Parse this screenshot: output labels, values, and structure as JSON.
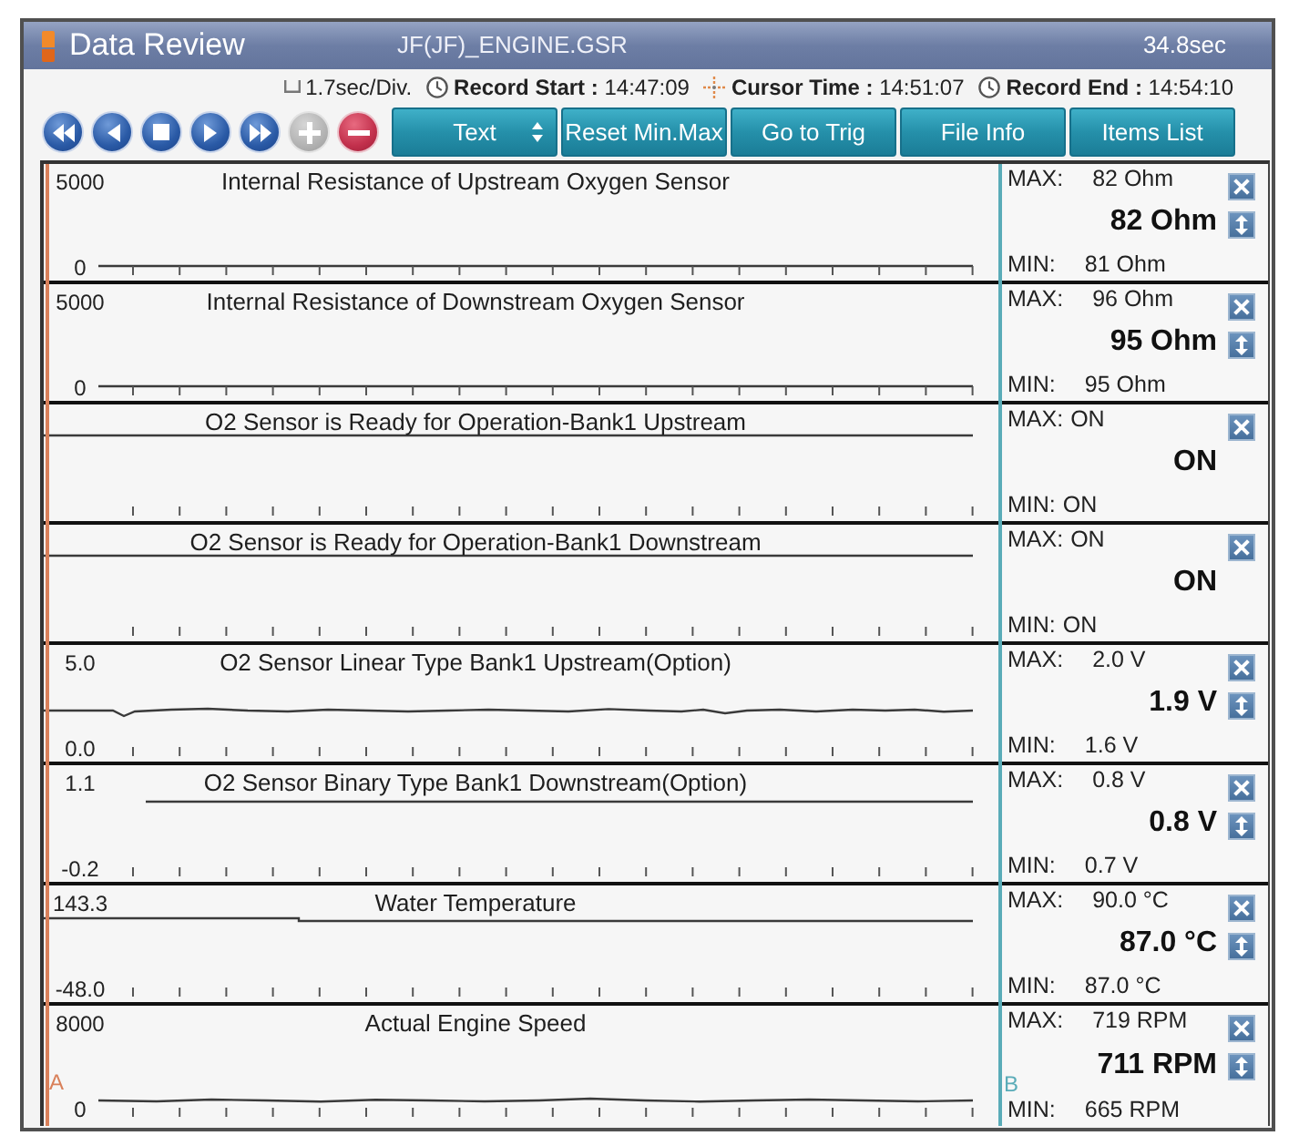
{
  "window": {
    "title": "Data Review",
    "file": "JF(JF)_ENGINE.GSR",
    "duration": "34.8sec"
  },
  "info_bar": [
    {
      "kind": "division",
      "text": "1.7sec/Div."
    },
    {
      "kind": "start",
      "text": "**Record Start :** 14:47:09"
    },
    {
      "kind": "cursor",
      "text": "**Cursor Time :** 14:51:07"
    },
    {
      "kind": "end",
      "text": "**Record End :** 14:54:10"
    }
  ],
  "playback_buttons": [
    {
      "kind": "rewind",
      "disabled": false
    },
    {
      "kind": "back",
      "disabled": false
    },
    {
      "kind": "stop",
      "disabled": false
    },
    {
      "kind": "play",
      "disabled": false
    },
    {
      "kind": "forward",
      "disabled": false
    },
    {
      "kind": "add",
      "disabled": true
    },
    {
      "kind": "remove",
      "disabled": false
    }
  ],
  "toolbar_buttons": [
    {
      "kind": "dropdown",
      "label": "Text"
    },
    {
      "kind": "button",
      "label": "Reset Min.Max"
    },
    {
      "kind": "button",
      "label": "Go to Trig"
    },
    {
      "kind": "button",
      "label": "File Info"
    },
    {
      "kind": "button",
      "label": "Items List"
    }
  ],
  "channels": [
    {
      "kind": "numeric",
      "title": "Internal Resistance of Upstream Oxygen Sensor",
      "scale_max": "5000",
      "scale_min": "0",
      "trace": {
        "kind": "baseline"
      },
      "max_label": "MAX:",
      "max": "82 Ohm",
      "value": "82 Ohm",
      "min_label": "MIN:",
      "min": "81 Ohm"
    },
    {
      "kind": "numeric",
      "title": "Internal Resistance of Downstream Oxygen Sensor",
      "scale_max": "5000",
      "scale_min": "0",
      "trace": {
        "kind": "baseline"
      },
      "max_label": "MAX:",
      "max": "96 Ohm",
      "value": "95 Ohm",
      "min_label": "MIN:",
      "min": "95 Ohm"
    },
    {
      "kind": "state",
      "title": "O2 Sensor is Ready for Operation-Bank1 Upstream",
      "trace": {
        "kind": "top"
      },
      "max_label": "MAX:",
      "max": "ON",
      "value": "ON",
      "min_label": "MIN:",
      "min": "ON"
    },
    {
      "kind": "state",
      "title": "O2 Sensor is Ready for Operation-Bank1 Downstream",
      "trace": {
        "kind": "top"
      },
      "max_label": "MAX:",
      "max": "ON",
      "value": "ON",
      "min_label": "MIN:",
      "min": "ON"
    },
    {
      "kind": "numeric",
      "title": "O2 Sensor Linear Type Bank1 Upstream(Option)",
      "scale_max": "5.0",
      "scale_min": "0.0",
      "trace": {
        "kind": "wave"
      },
      "max_label": "MAX:",
      "max": "2.0 V",
      "value": "1.9 V",
      "min_label": "MIN:",
      "min": "1.6 V"
    },
    {
      "kind": "numeric",
      "title": "O2 Sensor Binary Type Bank1 Downstream(Option)",
      "scale_max": "1.1",
      "scale_min": "-0.2",
      "trace": {
        "kind": "upper"
      },
      "max_label": "MAX:",
      "max": "0.8 V",
      "value": "0.8 V",
      "min_label": "MIN:",
      "min": "0.7 V"
    },
    {
      "kind": "numeric",
      "title": "Water Temperature",
      "scale_max": "143.3",
      "scale_min": "-48.0",
      "trace": {
        "kind": "step"
      },
      "max_label": "MAX:",
      "max": "90.0 °C",
      "value": "87.0 °C",
      "min_label": "MIN:",
      "min": "87.0 °C"
    },
    {
      "kind": "numeric",
      "title": "Actual Engine Speed",
      "scale_max": "8000",
      "scale_min": "0",
      "trace": {
        "kind": "wave_low"
      },
      "max_label": "MAX:",
      "max": "719 RPM",
      "value": "711 RPM",
      "min_label": "MIN:",
      "min": "665 RPM"
    }
  ],
  "cursors": [
    {
      "label": "A",
      "color": "#d9805a"
    },
    {
      "label": "B",
      "color": "#5aacb8"
    }
  ]
}
